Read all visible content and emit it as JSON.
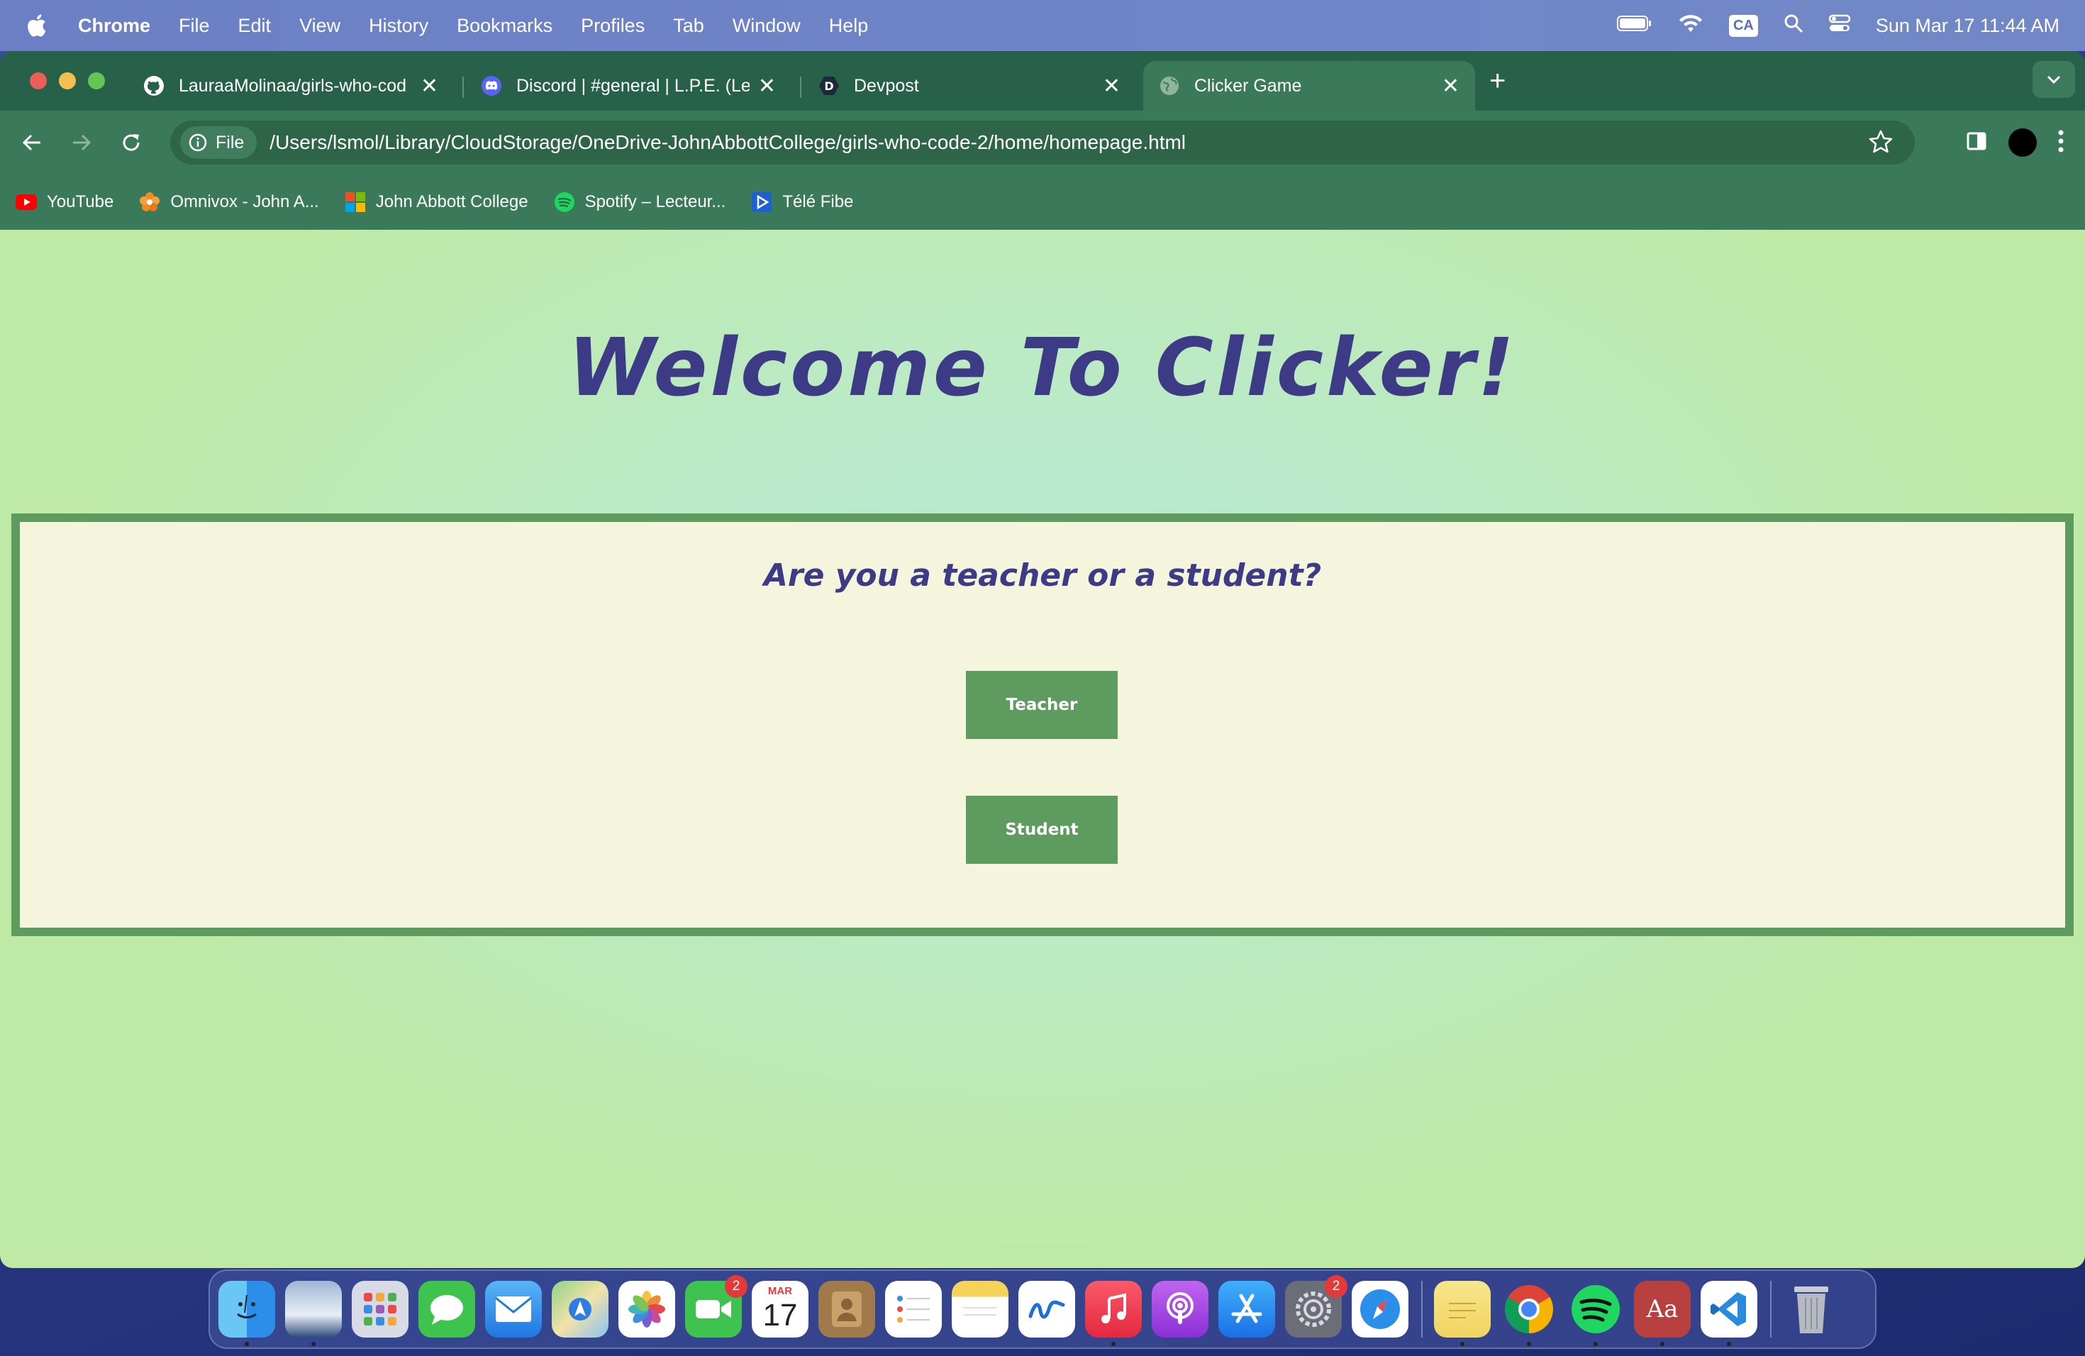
{
  "menubar": {
    "app_name": "Chrome",
    "items": [
      "File",
      "Edit",
      "View",
      "History",
      "Bookmarks",
      "Profiles",
      "Tab",
      "Window",
      "Help"
    ],
    "input_source": "CA",
    "clock": "Sun Mar 17  11:44 AM"
  },
  "tabs": [
    {
      "title": "LauraaMolinaa/girls-who-cod",
      "icon": "github-icon",
      "active": false
    },
    {
      "title": "Discord | #general | L.P.E. (Le",
      "icon": "discord-icon",
      "active": false
    },
    {
      "title": "Devpost",
      "icon": "devpost-icon",
      "icon_letter": "D",
      "active": false
    },
    {
      "title": "Clicker Game",
      "icon": "globe-icon",
      "active": true
    }
  ],
  "omnibox": {
    "scheme_chip": "File",
    "url": "/Users/lsmol/Library/CloudStorage/OneDrive-JohnAbbottCollege/girls-who-code-2/home/homepage.html"
  },
  "bookmarks": [
    {
      "label": "YouTube",
      "icon": "youtube-icon"
    },
    {
      "label": "Omnivox - John A...",
      "icon": "omnivox-icon"
    },
    {
      "label": "John Abbott College",
      "icon": "microsoft-icon"
    },
    {
      "label": "Spotify – Lecteur...",
      "icon": "spotify-icon"
    },
    {
      "label": "Télé Fibe",
      "icon": "tele-fibe-icon"
    }
  ],
  "page": {
    "title": "Welcome To Clicker!",
    "question": "Are you a teacher or a student?",
    "teacher_button": "Teacher",
    "student_button": "Student"
  },
  "dock": {
    "facetime_badge": "2",
    "calendar_month": "MAR",
    "calendar_day": "17",
    "settings_badge": "2",
    "dictionary_label": "Aa"
  },
  "colors": {
    "title_color": "#3d3b86",
    "button_green": "#5e9b5e",
    "panel_bg": "#f5f4dd",
    "browser_green": "#3a7a5a"
  }
}
